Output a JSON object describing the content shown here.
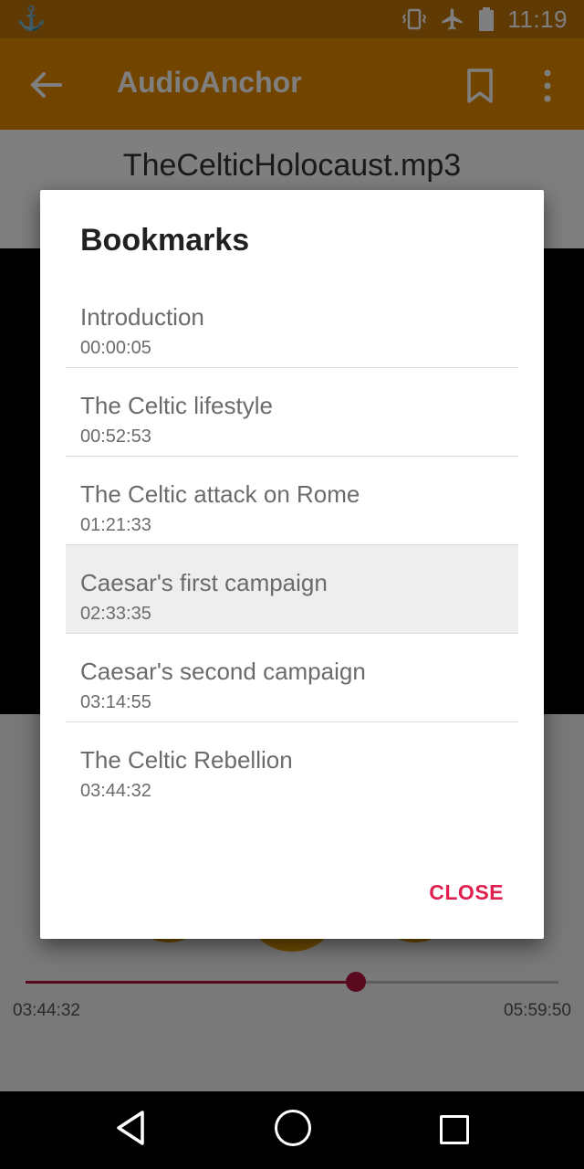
{
  "status_bar": {
    "time": "11:19"
  },
  "app_bar": {
    "title": "AudioAnchor"
  },
  "player": {
    "file_name": "TheCelticHolocaust.mp3",
    "current_time": "03:44:32",
    "total_time": "05:59:50",
    "progress_fraction": 0.62
  },
  "dialog": {
    "title": "Bookmarks",
    "close_label": "CLOSE",
    "bookmarks": [
      {
        "name": "Introduction",
        "time": "00:00:05"
      },
      {
        "name": "The Celtic lifestyle",
        "time": "00:52:53"
      },
      {
        "name": "The Celtic attack on Rome",
        "time": "01:21:33"
      },
      {
        "name": "Caesar's first campaign",
        "time": "02:33:35"
      },
      {
        "name": "Caesar's second campaign",
        "time": "03:14:55"
      },
      {
        "name": "The Celtic Rebellion",
        "time": "03:44:32"
      }
    ]
  },
  "colors": {
    "accent": "#e0204f",
    "app_bar": "#e38a00",
    "progress": "#b5153d"
  }
}
